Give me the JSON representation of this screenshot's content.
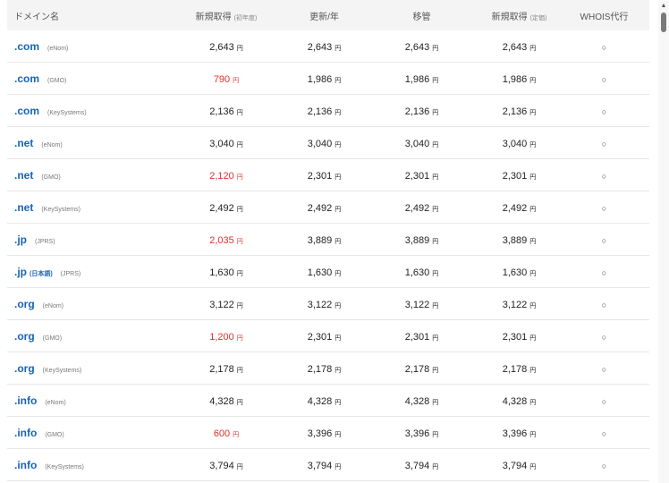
{
  "header": {
    "domain": "ドメイン名",
    "new_first": "新規取得",
    "new_first_note": "(初年度)",
    "renew": "更新/年",
    "transfer": "移管",
    "new_regular": "新規取得",
    "new_regular_note": "(定価)",
    "whois": "WHOIS代行"
  },
  "colors": {
    "tld": "#1863b8",
    "discount": "#e03030",
    "header_bg": "#f4f4f4"
  },
  "rows": [
    {
      "tld": ".com",
      "tag": "",
      "registrar": "(eNom)",
      "new_first": "2,643",
      "new_first_red": false,
      "renew": "2,643",
      "transfer": "2,643",
      "new_regular": "2,643",
      "whois": "○"
    },
    {
      "tld": ".com",
      "tag": "",
      "registrar": "(GMO)",
      "new_first": "790",
      "new_first_red": true,
      "renew": "1,986",
      "transfer": "1,986",
      "new_regular": "1,986",
      "whois": "○"
    },
    {
      "tld": ".com",
      "tag": "",
      "registrar": "(KeySystems)",
      "new_first": "2,136",
      "new_first_red": false,
      "renew": "2,136",
      "transfer": "2,136",
      "new_regular": "2,136",
      "whois": "○"
    },
    {
      "tld": ".net",
      "tag": "",
      "registrar": "(eNom)",
      "new_first": "3,040",
      "new_first_red": false,
      "renew": "3,040",
      "transfer": "3,040",
      "new_regular": "3,040",
      "whois": "○"
    },
    {
      "tld": ".net",
      "tag": "",
      "registrar": "(GMO)",
      "new_first": "2,120",
      "new_first_red": true,
      "renew": "2,301",
      "transfer": "2,301",
      "new_regular": "2,301",
      "whois": "○"
    },
    {
      "tld": ".net",
      "tag": "",
      "registrar": "(KeySystems)",
      "new_first": "2,492",
      "new_first_red": false,
      "renew": "2,492",
      "transfer": "2,492",
      "new_regular": "2,492",
      "whois": "○"
    },
    {
      "tld": ".jp",
      "tag": "",
      "registrar": "(JPRS)",
      "new_first": "2,035",
      "new_first_red": true,
      "renew": "3,889",
      "transfer": "3,889",
      "new_regular": "3,889",
      "whois": "○"
    },
    {
      "tld": ".jp",
      "tag": "(日本語)",
      "registrar": "(JPRS)",
      "new_first": "1,630",
      "new_first_red": false,
      "renew": "1,630",
      "transfer": "1,630",
      "new_regular": "1,630",
      "whois": "○"
    },
    {
      "tld": ".org",
      "tag": "",
      "registrar": "(eNom)",
      "new_first": "3,122",
      "new_first_red": false,
      "renew": "3,122",
      "transfer": "3,122",
      "new_regular": "3,122",
      "whois": "○"
    },
    {
      "tld": ".org",
      "tag": "",
      "registrar": "(GMO)",
      "new_first": "1,200",
      "new_first_red": true,
      "renew": "2,301",
      "transfer": "2,301",
      "new_regular": "2,301",
      "whois": "○"
    },
    {
      "tld": ".org",
      "tag": "",
      "registrar": "(KeySystems)",
      "new_first": "2,178",
      "new_first_red": false,
      "renew": "2,178",
      "transfer": "2,178",
      "new_regular": "2,178",
      "whois": "○"
    },
    {
      "tld": ".info",
      "tag": "",
      "registrar": "(eNom)",
      "new_first": "4,328",
      "new_first_red": false,
      "renew": "4,328",
      "transfer": "4,328",
      "new_regular": "4,328",
      "whois": "○"
    },
    {
      "tld": ".info",
      "tag": "",
      "registrar": "(GMO)",
      "new_first": "600",
      "new_first_red": true,
      "renew": "3,396",
      "transfer": "3,396",
      "new_regular": "3,396",
      "whois": "○"
    },
    {
      "tld": ".info",
      "tag": "",
      "registrar": "(KeySystems)",
      "new_first": "3,794",
      "new_first_red": false,
      "renew": "3,794",
      "transfer": "3,794",
      "new_regular": "3,794",
      "whois": "○"
    }
  ],
  "unit": "円",
  "scrollbar": {
    "up_arrow": "▲"
  }
}
